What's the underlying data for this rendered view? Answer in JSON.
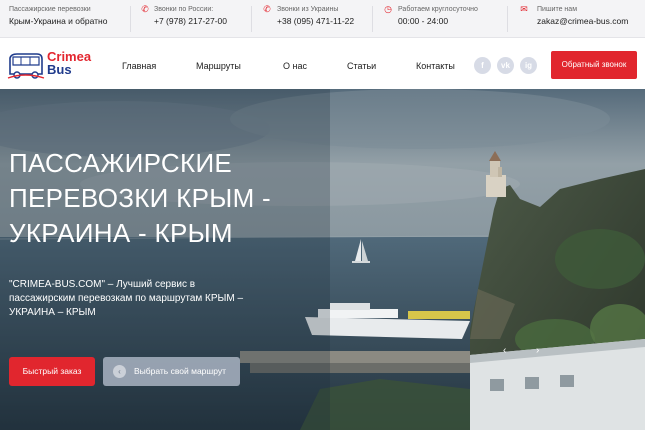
{
  "topbar": {
    "tagline_small": "Пассажирские перевозки",
    "tagline_main": "Крым-Украина и обратно",
    "russia_label": "Звонки по России:",
    "russia_phone": "+7 (978) 217-27-00",
    "ukraine_label": "Звонки из Украины",
    "ukraine_phone": "+38 (095) 471-11-22",
    "hours_label": "Работаем круглосуточно",
    "hours_value": "00:00 - 24:00",
    "email_label": "Пишите нам",
    "email_value": "zakaz@crimea-bus.com"
  },
  "logo": {
    "line1": "Crimea",
    "line2": "Bus"
  },
  "nav": {
    "items": [
      "Главная",
      "Маршруты",
      "О нас",
      "Статьи",
      "Контакты"
    ]
  },
  "social": {
    "facebook": "f",
    "vk": "vk",
    "instagram": "ig"
  },
  "callback_button": "Обратный звонок",
  "hero": {
    "title": "ПАССАЖИРСКИЕ ПЕРЕВОЗКИ КРЫМ - УКРАИНА - КРЫМ",
    "subtitle": "\"CRIMEA-BUS.COM\" – Лучший сервис в пассажирским перевозкам по маршрутам КРЫМ – УКРАИНА – КРЫМ",
    "quick_order": "Быстрый заказ",
    "choose_route": "Выбрать свой маршрут",
    "prev_arrow": "‹",
    "next_arrow": "›"
  },
  "colors": {
    "accent": "#e1262e",
    "brand_blue": "#1f3b8c"
  }
}
